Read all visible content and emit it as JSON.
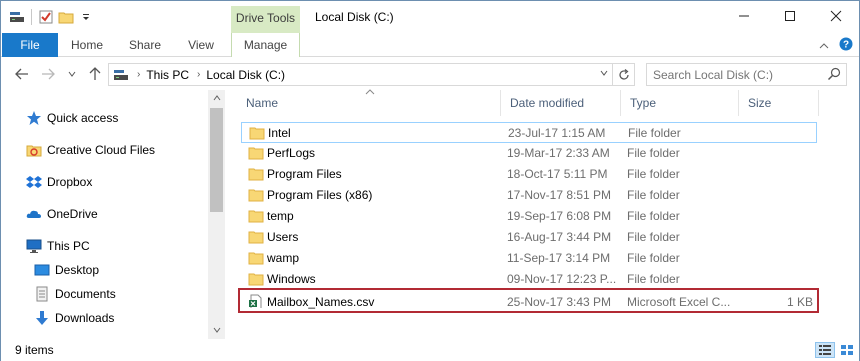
{
  "window": {
    "title": "Local Disk (C:)",
    "contextual_tab_group": "Drive Tools"
  },
  "ribbon": {
    "file_tab": "File",
    "tabs": [
      "Home",
      "Share",
      "View",
      "Manage"
    ]
  },
  "address_bar": {
    "crumbs": [
      "This PC",
      "Local Disk (C:)"
    ]
  },
  "search": {
    "placeholder": "Search Local Disk (C:)"
  },
  "nav_pane": {
    "items": [
      {
        "label": "Quick access",
        "icon": "star-icon"
      },
      {
        "label": "Creative Cloud Files",
        "icon": "creative-cloud-icon"
      },
      {
        "label": "Dropbox",
        "icon": "dropbox-icon"
      },
      {
        "label": "OneDrive",
        "icon": "onedrive-icon"
      },
      {
        "label": "This PC",
        "icon": "computer-icon"
      },
      {
        "label": "Desktop",
        "icon": "desktop-icon"
      },
      {
        "label": "Documents",
        "icon": "documents-icon"
      },
      {
        "label": "Downloads",
        "icon": "downloads-icon"
      }
    ]
  },
  "columns": {
    "name": "Name",
    "date": "Date modified",
    "type": "Type",
    "size": "Size"
  },
  "files": [
    {
      "name": "Intel",
      "date": "23-Jul-17 1:15 AM",
      "type": "File folder",
      "size": "",
      "icon": "folder-icon"
    },
    {
      "name": "PerfLogs",
      "date": "19-Mar-17 2:33 AM",
      "type": "File folder",
      "size": "",
      "icon": "folder-icon"
    },
    {
      "name": "Program Files",
      "date": "18-Oct-17 5:11 PM",
      "type": "File folder",
      "size": "",
      "icon": "folder-icon"
    },
    {
      "name": "Program Files (x86)",
      "date": "17-Nov-17 8:51 PM",
      "type": "File folder",
      "size": "",
      "icon": "folder-icon"
    },
    {
      "name": "temp",
      "date": "19-Sep-17 6:08 PM",
      "type": "File folder",
      "size": "",
      "icon": "folder-icon"
    },
    {
      "name": "Users",
      "date": "16-Aug-17 3:44 PM",
      "type": "File folder",
      "size": "",
      "icon": "folder-icon"
    },
    {
      "name": "wamp",
      "date": "11-Sep-17 3:14 PM",
      "type": "File folder",
      "size": "",
      "icon": "folder-icon"
    },
    {
      "name": "Windows",
      "date": "09-Nov-17 12:23 P...",
      "type": "File folder",
      "size": "",
      "icon": "folder-icon"
    },
    {
      "name": "Mailbox_Names.csv",
      "date": "25-Nov-17 3:43 PM",
      "type": "Microsoft Excel C...",
      "size": "1 KB",
      "icon": "excel-csv-icon"
    }
  ],
  "status": {
    "item_count": "9 items"
  },
  "colors": {
    "file_tab": "#1979ca",
    "drive_tools": "#d8eac4",
    "highlight_border": "#b22a34",
    "focus_border": "#99d1ff"
  }
}
